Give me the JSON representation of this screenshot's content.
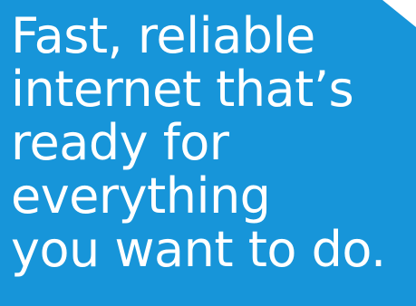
{
  "background": {
    "panel_color": "#1795d9",
    "page_color": "#ffffff"
  },
  "headline": {
    "lines": [
      "Fast, reliable",
      "internet that’s",
      "ready for",
      "everything",
      "you want to do."
    ],
    "text_color": "#ffffff"
  }
}
